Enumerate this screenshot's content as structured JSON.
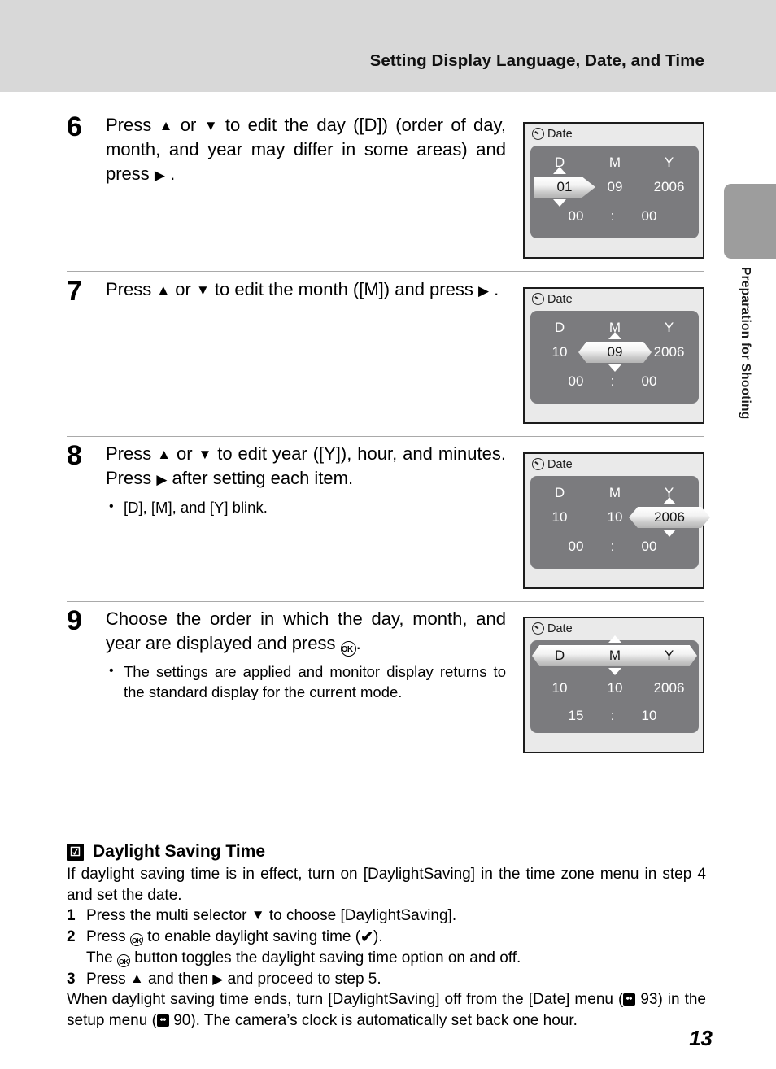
{
  "header": {
    "title": "Setting Display Language, Date, and Time"
  },
  "side_tab": {
    "label": "Preparation for Shooting"
  },
  "page_number": "13",
  "steps": [
    {
      "number": "6",
      "text_parts": {
        "a": "Press ",
        "up": "▲",
        "b": " or ",
        "down": "▼",
        "c": " to edit the day ([D]) (order of day, month, and year may differ in some areas) and press ",
        "right": "▶",
        "d": " ."
      },
      "bullets": [],
      "screen": {
        "title": "Date",
        "icon": "clock-icon",
        "headers": [
          "D",
          "M",
          "Y"
        ],
        "values": [
          "01",
          "09",
          "2006"
        ],
        "time": [
          "00",
          ":",
          "00"
        ],
        "highlight": "day",
        "highlight_style": "arrow-right"
      }
    },
    {
      "number": "7",
      "text_parts": {
        "a": "Press ",
        "up": "▲",
        "b": " or ",
        "down": "▼",
        "c": " to edit the month ([M]) and press ",
        "right": "▶",
        "d": " ."
      },
      "bullets": [],
      "screen": {
        "title": "Date",
        "icon": "clock-icon",
        "headers": [
          "D",
          "M",
          "Y"
        ],
        "values": [
          "10",
          "09",
          "2006"
        ],
        "time": [
          "00",
          ":",
          "00"
        ],
        "highlight": "month",
        "highlight_style": "hexagon"
      }
    },
    {
      "number": "8",
      "text_parts": {
        "a": "Press ",
        "up": "▲",
        "b": " or ",
        "down": "▼",
        "c": " to edit year ([Y]), hour, and minutes. Press ",
        "right": "▶",
        "d": " after setting each item."
      },
      "bullets": [
        "[D], [M], and [Y] blink."
      ],
      "screen": {
        "title": "Date",
        "icon": "clock-icon",
        "headers": [
          "D",
          "M",
          "Y"
        ],
        "values": [
          "10",
          "10",
          "2006"
        ],
        "time": [
          "00",
          ":",
          "00"
        ],
        "highlight": "year",
        "highlight_style": "hexagon"
      }
    },
    {
      "number": "9",
      "text_parts": {
        "a": "Choose the order in which the day, month, and year are displayed and press ",
        "ok": "OK",
        "d": "."
      },
      "bullets": [
        "The settings are applied and monitor display returns to the standard display for the current mode."
      ],
      "screen": {
        "title": "Date",
        "icon": "clock-icon",
        "headers": [
          "D",
          "M",
          "Y"
        ],
        "values": [
          "10",
          "10",
          "2006"
        ],
        "time": [
          "15",
          ":",
          "10"
        ],
        "highlight": "order-row",
        "highlight_style": "hexagon-wide"
      }
    }
  ],
  "note": {
    "mark": "☑",
    "title": "Daylight Saving Time",
    "intro": "If daylight saving time is in effect, turn on [DaylightSaving] in the time zone menu in step 4 and set the date.",
    "items": [
      {
        "num": "1",
        "pre": "Press the multi selector ",
        "glyph": "▼",
        "post": " to choose [DaylightSaving]."
      },
      {
        "num": "2",
        "pre": "Press ",
        "glyph": "OK",
        "post": " to enable daylight saving time (",
        "check": "✔",
        "tail": ")."
      }
    ],
    "sub_line": {
      "pre": "The ",
      "glyph": "OK",
      "post": " button toggles the daylight saving time option on and off."
    },
    "item3": {
      "num": "3",
      "pre": "Press ",
      "up": "▲",
      "mid": " and then ",
      "right": "▶",
      "post": " and proceed to step 5."
    },
    "closing": {
      "a": "When daylight saving time ends, turn [DaylightSaving] off from the [Date] menu (",
      "ref1": "93",
      "b": ") in the setup menu (",
      "ref2": "90",
      "c": "). The camera’s clock is automatically set back one hour."
    }
  }
}
